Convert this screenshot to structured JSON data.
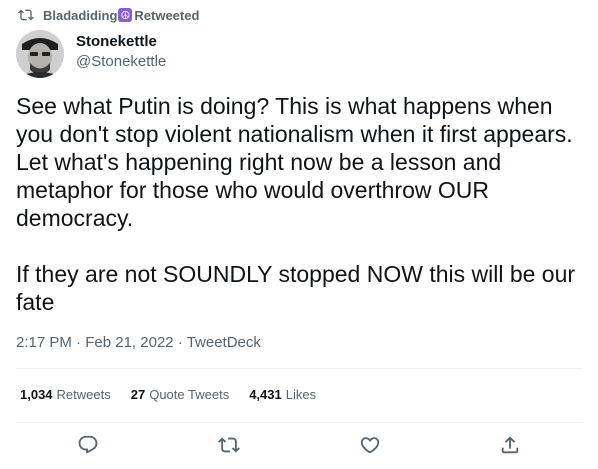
{
  "retweet": {
    "icon": "retweet-icon",
    "user": "Bladadiding",
    "badge_icon": "peace-icon",
    "label": "Retweeted"
  },
  "author": {
    "avatar_icon": "avatar-photo",
    "display_name": "Stonekettle",
    "handle": "@Stonekettle"
  },
  "tweet": {
    "paragraph1": "See what Putin is doing? This is what happens when you don't stop violent nationalism when it first appears. Let what's happening right now be a lesson and metaphor for those who would overthrow OUR democracy.",
    "paragraph2": "If they are not SOUNDLY stopped NOW this will be our fate"
  },
  "meta": {
    "time": "2:17 PM",
    "separator": " · ",
    "date": "Feb 21, 2022",
    "source": "TweetDeck"
  },
  "stats": {
    "retweets_count": "1,034",
    "retweets_label": "Retweets",
    "quotes_count": "27",
    "quotes_label": "Quote Tweets",
    "likes_count": "4,431",
    "likes_label": "Likes"
  },
  "actions": {
    "icons": [
      "reply-icon",
      "retweet-icon",
      "like-icon",
      "share-icon"
    ],
    "color": "#536471"
  },
  "colors": {
    "text_primary": "#0f1419",
    "text_secondary": "#536471",
    "divider": "#eff3f4",
    "badge": "#8a5dd6"
  }
}
